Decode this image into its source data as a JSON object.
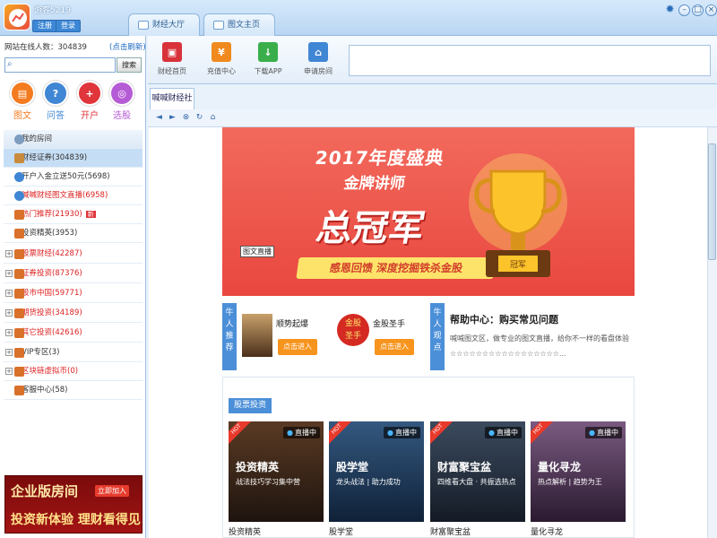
{
  "app": {
    "title": "游客5219",
    "register": "注册",
    "login": "登录"
  },
  "tabs": [
    {
      "label": "财经大厅"
    },
    {
      "label": "图文主页"
    }
  ],
  "left": {
    "online": "网站在线人数：304839",
    "refresh": "(点击刷新)",
    "search_placeholder": "",
    "search_btn": "搜索",
    "quick": [
      {
        "label": "图文",
        "color": "#f47b20",
        "glyph": "▤"
      },
      {
        "label": "问答",
        "color": "#3f86d4",
        "glyph": "?"
      },
      {
        "label": "开户",
        "color": "#e0353a",
        "glyph": "+"
      },
      {
        "label": "选股",
        "color": "#b65bd6",
        "glyph": "◎"
      }
    ],
    "rows": [
      {
        "label": "我的房间",
        "type": "hdr",
        "exp": ""
      },
      {
        "label": "财经证券(304839)",
        "type": "sel",
        "exp": ""
      },
      {
        "label": "开户入金立送50元(5698)",
        "type": "",
        "exp": ""
      },
      {
        "label": "喊喊财经图文直播(6958)",
        "type": "",
        "exp": ""
      },
      {
        "label": "热门推荐(21930)",
        "type": "",
        "exp": ""
      },
      {
        "label": "投资精英(3953)",
        "type": "",
        "exp": ""
      },
      {
        "label": "股票财经(42287)",
        "type": "",
        "exp": "+"
      },
      {
        "label": "证券投资(87376)",
        "type": "",
        "exp": "+"
      },
      {
        "label": "股市中国(59771)",
        "type": "",
        "exp": "+"
      },
      {
        "label": "期货投资(34189)",
        "type": "",
        "exp": "+"
      },
      {
        "label": "其它投资(42616)",
        "type": "",
        "exp": "+"
      },
      {
        "label": "VIP专区(3)",
        "type": "",
        "exp": "+"
      },
      {
        "label": "区块链虚拟币(0)",
        "type": "",
        "exp": "+"
      },
      {
        "label": "客服中心(58)",
        "type": "",
        "exp": ""
      }
    ],
    "hot_badge": "新",
    "ad": {
      "line1": "企业版房间",
      "tag": "立即加入",
      "line2": "投资新体验 理财看得见"
    }
  },
  "toolbar": [
    {
      "label": "财经首页",
      "color": "#d8323a",
      "glyph": "▣"
    },
    {
      "label": "充值中心",
      "color": "#f08a1e",
      "glyph": "¥"
    },
    {
      "label": "下载APP",
      "color": "#3aae4a",
      "glyph": "↓"
    },
    {
      "label": "申请房间",
      "color": "#3f86d4",
      "glyph": "⌂"
    }
  ],
  "subtab": "喊喊财经社区",
  "banner": {
    "year": "2017年度盛典",
    "line2": "金牌讲师",
    "line3": "总冠军",
    "slogan": "感恩回馈 深度挖掘铁杀金股",
    "trophy_label": "冠军"
  },
  "live_tag": "图文直播",
  "recommend": {
    "tag": "牛人推荐",
    "items": [
      {
        "name": "顺势起爆",
        "btn": "点击进入"
      },
      {
        "name": "金股圣手",
        "btn": "点击进入"
      }
    ],
    "view_tag": "牛人观点",
    "help_title": "帮助中心：购买常见问题",
    "help_text": "喊喊图文区，做专业的图文直播，给你不一样的看盘体验",
    "stars": "☆☆☆☆☆☆☆☆☆☆☆☆☆☆☆☆☆..."
  },
  "stock": {
    "title": "股票投资",
    "cards": [
      {
        "title": "投资精英",
        "sub": "战法技巧学习集中营",
        "live": "直播中",
        "name": "投资精英",
        "bg": "#3a2a1e"
      },
      {
        "title": "股学堂",
        "sub": "龙头战法 | 助力成功",
        "live": "直播中",
        "name": "股学堂",
        "bg": "#1e3f63"
      },
      {
        "title": "财富聚宝盆",
        "sub": "四维看大盘 · 共振选热点",
        "live": "直播中",
        "name": "财富聚宝盆",
        "bg": "#2a3646"
      },
      {
        "title": "量化寻龙",
        "sub": "热点解析 | 趋势为王",
        "live": "直播中",
        "name": "量化寻龙",
        "bg": "#5a3a55"
      }
    ]
  }
}
